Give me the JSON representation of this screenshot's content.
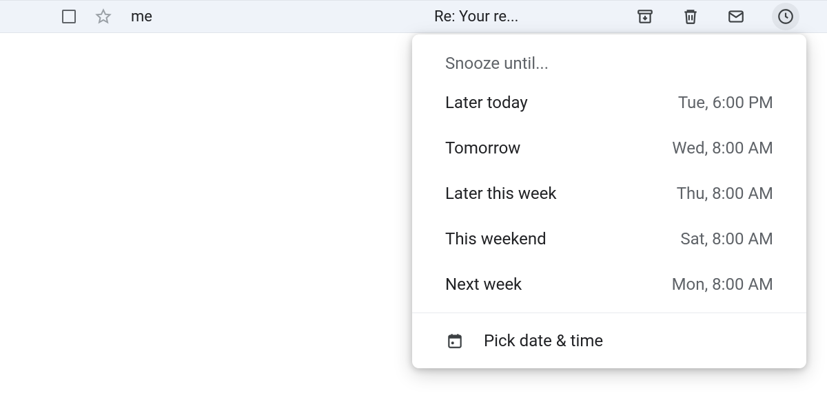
{
  "row": {
    "sender": "me",
    "subject": "Re: Your re..."
  },
  "actions": {
    "archive": "archive",
    "delete": "delete",
    "mark_unread": "mark-unread",
    "snooze": "snooze"
  },
  "snooze": {
    "title": "Snooze until...",
    "options": [
      {
        "label": "Later today",
        "time": "Tue, 6:00 PM"
      },
      {
        "label": "Tomorrow",
        "time": "Wed, 8:00 AM"
      },
      {
        "label": "Later this week",
        "time": "Thu, 8:00 AM"
      },
      {
        "label": "This weekend",
        "time": "Sat, 8:00 AM"
      },
      {
        "label": "Next week",
        "time": "Mon, 8:00 AM"
      }
    ],
    "pick_label": "Pick date & time"
  }
}
